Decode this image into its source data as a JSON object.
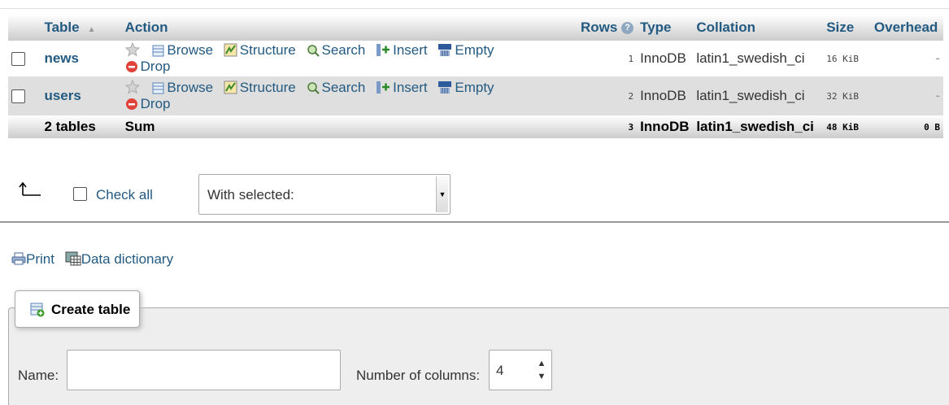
{
  "table": {
    "headers": {
      "table": "Table",
      "sort_indicator": "▲",
      "action": "Action",
      "rows": "Rows",
      "type": "Type",
      "collation": "Collation",
      "size": "Size",
      "overhead": "Overhead"
    },
    "action_labels": {
      "browse": "Browse",
      "structure": "Structure",
      "search": "Search",
      "insert": "Insert",
      "empty": "Empty",
      "drop": "Drop"
    },
    "rows": [
      {
        "name": "news",
        "rows": "1",
        "type": "InnoDB",
        "collation": "latin1_swedish_ci",
        "size": "16 KiB",
        "overhead": "-"
      },
      {
        "name": "users",
        "rows": "2",
        "type": "InnoDB",
        "collation": "latin1_swedish_ci",
        "size": "32 KiB",
        "overhead": "-"
      }
    ],
    "summary": {
      "count": "2 tables",
      "label": "Sum",
      "rows": "3",
      "type": "InnoDB",
      "collation": "latin1_swedish_ci",
      "size": "48 KiB",
      "overhead": "0 B"
    }
  },
  "bulk": {
    "check_all": "Check all",
    "with_selected": "With selected:"
  },
  "links": {
    "print": "Print",
    "data_dictionary": "Data dictionary"
  },
  "create_table": {
    "legend": "Create table",
    "name_label": "Name:",
    "name_value": "",
    "columns_label": "Number of columns:",
    "columns_value": "4"
  }
}
